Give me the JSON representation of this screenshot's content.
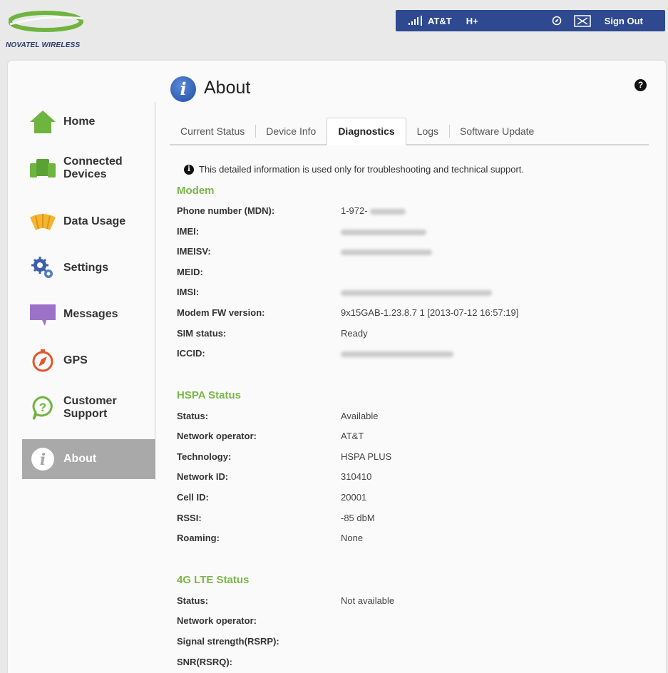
{
  "brand": {
    "logo_text": "NOVATEL WIRELESS",
    "accent_green": "#7ab648",
    "bar_blue": "#2e4990"
  },
  "statusbar": {
    "carrier": "AT&T",
    "network_type": "H+",
    "signout_label": "Sign Out"
  },
  "sidebar": {
    "items": [
      {
        "label": "Home",
        "icon": "home-icon"
      },
      {
        "label": "Connected Devices",
        "icon": "connected-devices-icon"
      },
      {
        "label": "Data Usage",
        "icon": "data-usage-icon"
      },
      {
        "label": "Settings",
        "icon": "gears-icon"
      },
      {
        "label": "Messages",
        "icon": "message-bubble-icon"
      },
      {
        "label": "GPS",
        "icon": "compass-icon"
      },
      {
        "label": "Customer Support",
        "icon": "support-icon"
      },
      {
        "label": "About",
        "icon": "info-icon",
        "active": true
      }
    ]
  },
  "page": {
    "title": "About",
    "help_glyph": "?"
  },
  "tabs": [
    "Current Status",
    "Device Info",
    "Diagnostics",
    "Logs",
    "Software Update"
  ],
  "active_tab": "Diagnostics",
  "notice": "This detailed information is used only for troubleshooting and technical support.",
  "modem": {
    "title": "Modem",
    "rows": [
      {
        "label": "Phone number (MDN):",
        "value": "1-972-"
      },
      {
        "label": "IMEI:",
        "value": ""
      },
      {
        "label": "IMEISV:",
        "value": ""
      },
      {
        "label": "MEID:",
        "value": ""
      },
      {
        "label": "IMSI:",
        "value": ""
      },
      {
        "label": "Modem FW version:",
        "value": "9x15GAB-1.23.8.7 1 [2013-07-12 16:57:19]"
      },
      {
        "label": "SIM status:",
        "value": "Ready"
      },
      {
        "label": "ICCID:",
        "value": ""
      }
    ]
  },
  "hspa": {
    "title": "HSPA Status",
    "rows": [
      {
        "label": "Status:",
        "value": "Available"
      },
      {
        "label": "Network operator:",
        "value": "AT&T"
      },
      {
        "label": "Technology:",
        "value": "HSPA PLUS"
      },
      {
        "label": "Network ID:",
        "value": "310410"
      },
      {
        "label": "Cell ID:",
        "value": "20001"
      },
      {
        "label": "RSSI:",
        "value": "-85 dbM"
      },
      {
        "label": "Roaming:",
        "value": "None"
      }
    ]
  },
  "lte": {
    "title": "4G LTE Status",
    "rows": [
      {
        "label": "Status:",
        "value": "Not available"
      },
      {
        "label": "Network operator:",
        "value": ""
      },
      {
        "label": "Signal strength(RSRP):",
        "value": ""
      },
      {
        "label": "SNR(RSRQ):",
        "value": ""
      }
    ]
  }
}
